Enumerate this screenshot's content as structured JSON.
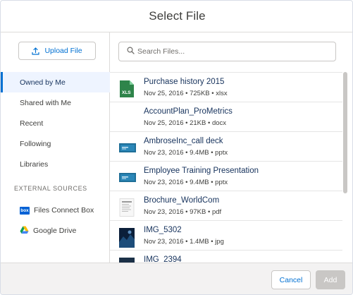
{
  "dialog": {
    "title": "Select File"
  },
  "sidebar": {
    "upload_label": "Upload File",
    "items": [
      {
        "label": "Owned by Me",
        "active": true
      },
      {
        "label": "Shared with Me",
        "active": false
      },
      {
        "label": "Recent",
        "active": false
      },
      {
        "label": "Following",
        "active": false
      },
      {
        "label": "Libraries",
        "active": false
      }
    ],
    "external_sources_label": "EXTERNAL SOURCES",
    "external_sources": [
      {
        "label": "Files Connect Box",
        "icon": "box-icon"
      },
      {
        "label": "Google Drive",
        "icon": "google-drive-icon"
      }
    ]
  },
  "search": {
    "placeholder": "Search Files..."
  },
  "files": [
    {
      "name": "Purchase history 2015",
      "meta": "Nov 25, 2016 • 725KB • xlsx",
      "icon": "excel-icon"
    },
    {
      "name": "AccountPlan_ProMetrics",
      "meta": "Nov 25, 2016 • 21KB • docx",
      "icon": "none"
    },
    {
      "name": "AmbroseInc_call deck",
      "meta": "Nov 23, 2016 • 9.4MB • pptx",
      "icon": "slide-thumbnail"
    },
    {
      "name": "Employee Training Presentation",
      "meta": "Nov 23, 2016 • 9.4MB • pptx",
      "icon": "slide-thumbnail"
    },
    {
      "name": "Brochure_WorldCom",
      "meta": "Nov 23, 2016 • 97KB • pdf",
      "icon": "document-thumbnail"
    },
    {
      "name": "IMG_5302",
      "meta": "Nov 23, 2016 • 1.4MB • jpg",
      "icon": "photo-thumbnail"
    },
    {
      "name": "IMG_2394",
      "meta": "",
      "icon": "photo-thumbnail"
    }
  ],
  "footer": {
    "cancel_label": "Cancel",
    "add_label": "Add"
  },
  "colors": {
    "accent": "#0070d2",
    "active_bg": "#eef4ff",
    "excel": "#2e844a",
    "disabled": "#c9c7c5"
  }
}
